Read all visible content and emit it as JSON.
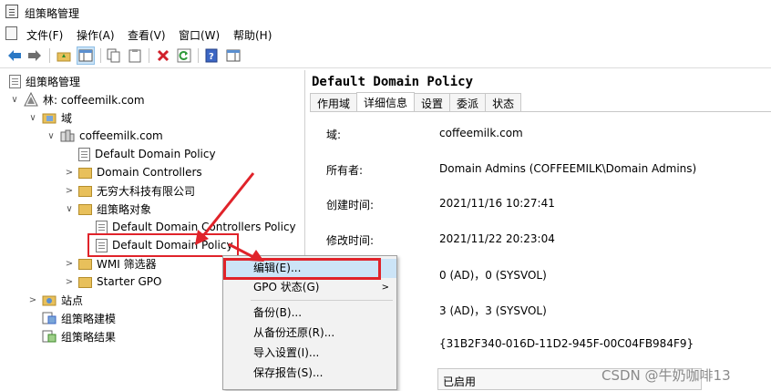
{
  "window": {
    "title": "组策略管理"
  },
  "menu": [
    "文件(F)",
    "操作(A)",
    "查看(V)",
    "窗口(W)",
    "帮助(H)"
  ],
  "tree": {
    "root": "组策略管理",
    "forest": "林: coffeemilk.com",
    "domains": "域",
    "domain": "coffeemilk.com",
    "default_policy": "Default Domain Policy",
    "dc": "Domain Controllers",
    "ou_company": "无穷大科技有限公司",
    "gpo_objects": "组策略对象",
    "gpo_dc_policy": "Default Domain Controllers Policy",
    "gpo_default_policy": "Default Domain Policy",
    "wmi": "WMI 筛选器",
    "starter": "Starter GPO",
    "sites": "站点",
    "modeling": "组策略建模",
    "results": "组策略结果"
  },
  "detail": {
    "header": "Default Domain Policy",
    "tabs": [
      "作用域",
      "详细信息",
      "设置",
      "委派",
      "状态"
    ],
    "labels": {
      "domain": "域:",
      "owner": "所有者:",
      "created": "创建时间:",
      "modified": "修改时间:"
    },
    "values": {
      "domain": "coffeemilk.com",
      "owner": "Domain Admins (COFFEEMILK\\Domain Admins)",
      "created": "2021/11/16 10:27:41",
      "modified": "2021/11/22 20:23:04",
      "user_version": "0 (AD)，0 (SYSVOL)",
      "computer_version": "3 (AD)，3 (SYSVOL)",
      "unique_id": "{31B2F340-016D-11D2-945F-00C04FB984F9}",
      "status": "已启用"
    }
  },
  "context_menu": {
    "edit": "编辑(E)...",
    "gpo_status": "GPO 状态(G)",
    "backup": "备份(B)...",
    "restore": "从备份还原(R)...",
    "import": "导入设置(I)...",
    "report": "保存报告(S)..."
  },
  "watermark": "CSDN @牛奶咖啡13",
  "colors": {
    "highlight": "#cce4f7",
    "annotation_red": "#e0232a",
    "folder": "#e8c05b"
  }
}
